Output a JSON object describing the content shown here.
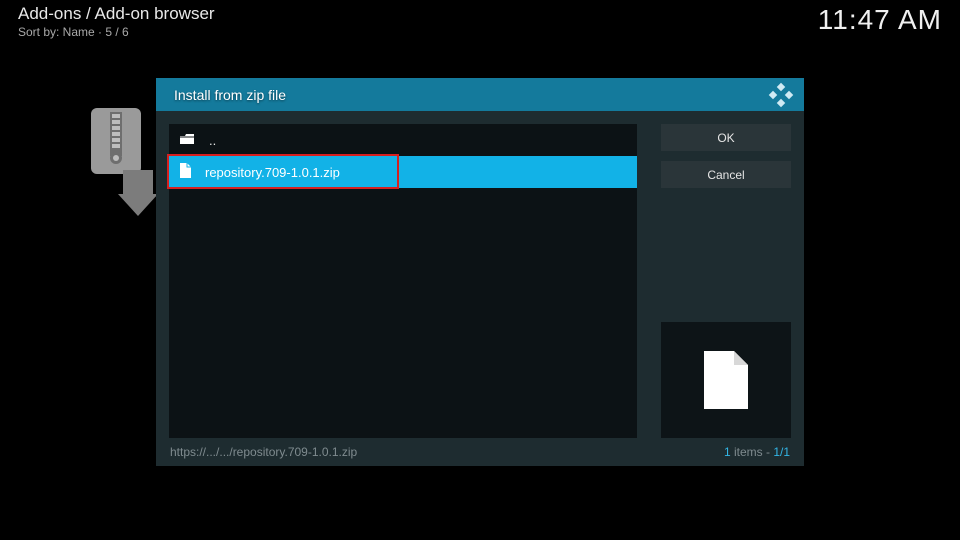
{
  "header": {
    "breadcrumb": "Add-ons / Add-on browser",
    "sortline": "Sort by: Name  ·  5 / 6",
    "clock": "11:47 AM"
  },
  "dialog": {
    "title": "Install from zip file",
    "items": {
      "up": "..",
      "file": "repository.709-1.0.1.zip"
    },
    "buttons": {
      "ok": "OK",
      "cancel": "Cancel"
    },
    "footer": {
      "path": "https://.../.../repository.709-1.0.1.zip",
      "count_num": "1",
      "count_word": " items - ",
      "count_page": "1/1"
    }
  }
}
